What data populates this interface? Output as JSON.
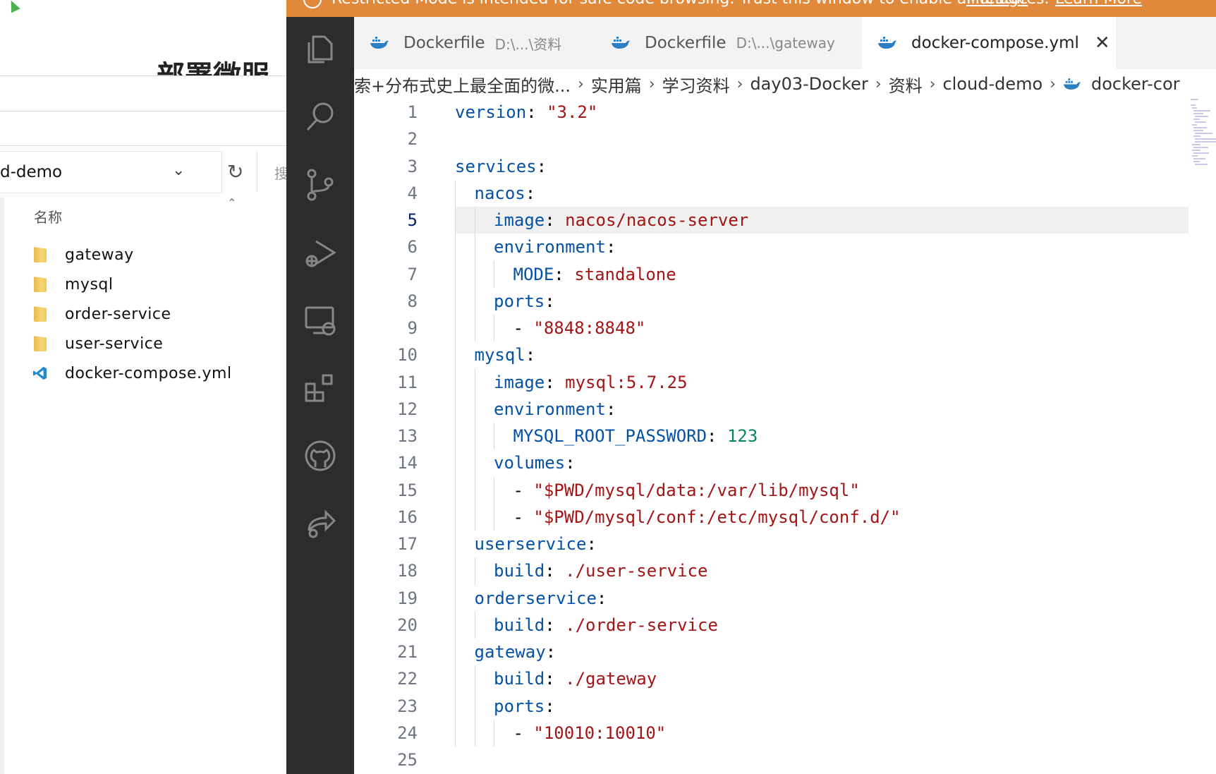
{
  "explorer": {
    "title": "部署微服",
    "path": "d-demo",
    "search_hint": "搜",
    "column_header": "名称",
    "files": [
      {
        "name": "gateway",
        "type": "folder"
      },
      {
        "name": "mysql",
        "type": "folder"
      },
      {
        "name": "order-service",
        "type": "folder"
      },
      {
        "name": "user-service",
        "type": "folder"
      },
      {
        "name": "docker-compose.yml",
        "type": "vscode-file"
      }
    ]
  },
  "vscode": {
    "banner": {
      "text": "Restricted Mode is intended for safe code browsing. Trust this window to enable all features.",
      "manage": "Manage",
      "learn_more": "Learn More"
    },
    "activity_icons": [
      "files-icon",
      "search-icon",
      "source-control-icon",
      "run-debug-icon",
      "remote-explorer-icon",
      "extensions-icon",
      "github-icon",
      "live-share-icon"
    ],
    "tabs": [
      {
        "label": "Dockerfile",
        "path": "D:\\...\\资料",
        "active": false
      },
      {
        "label": "Dockerfile",
        "path": "D:\\...\\gateway",
        "active": false
      },
      {
        "label": "docker-compose.yml",
        "path": "",
        "active": true
      }
    ],
    "breadcrumb": [
      "索+分布式史上最全面的微...",
      "实用篇",
      "学习资料",
      "day03-Docker",
      "资料",
      "cloud-demo",
      "docker-cor"
    ],
    "current_line": 5,
    "code_lines": [
      {
        "n": "1",
        "indent": 0,
        "parts": [
          [
            "k",
            "version"
          ],
          [
            "p",
            ": "
          ],
          [
            "s",
            "\"3.2\""
          ]
        ]
      },
      {
        "n": "2",
        "indent": 0,
        "parts": []
      },
      {
        "n": "3",
        "indent": 0,
        "parts": [
          [
            "k",
            "services"
          ],
          [
            "p",
            ":"
          ]
        ]
      },
      {
        "n": "4",
        "indent": 1,
        "parts": [
          [
            "k",
            "nacos"
          ],
          [
            "p",
            ":"
          ]
        ]
      },
      {
        "n": "5",
        "indent": 2,
        "parts": [
          [
            "k",
            "image"
          ],
          [
            "p",
            ": "
          ],
          [
            "v",
            "nacos/nacos-server"
          ]
        ]
      },
      {
        "n": "6",
        "indent": 2,
        "parts": [
          [
            "k",
            "environment"
          ],
          [
            "p",
            ":"
          ]
        ]
      },
      {
        "n": "7",
        "indent": 3,
        "parts": [
          [
            "k",
            "MODE"
          ],
          [
            "p",
            ": "
          ],
          [
            "v",
            "standalone"
          ]
        ]
      },
      {
        "n": "8",
        "indent": 2,
        "parts": [
          [
            "k",
            "ports"
          ],
          [
            "p",
            ":"
          ]
        ]
      },
      {
        "n": "9",
        "indent": 3,
        "parts": [
          [
            "p",
            "- "
          ],
          [
            "s",
            "\"8848:8848\""
          ]
        ]
      },
      {
        "n": "10",
        "indent": 1,
        "parts": [
          [
            "k",
            "mysql"
          ],
          [
            "p",
            ":"
          ]
        ]
      },
      {
        "n": "11",
        "indent": 2,
        "parts": [
          [
            "k",
            "image"
          ],
          [
            "p",
            ": "
          ],
          [
            "v",
            "mysql:5.7.25"
          ]
        ]
      },
      {
        "n": "12",
        "indent": 2,
        "parts": [
          [
            "k",
            "environment"
          ],
          [
            "p",
            ":"
          ]
        ]
      },
      {
        "n": "13",
        "indent": 3,
        "parts": [
          [
            "k",
            "MYSQL_ROOT_PASSWORD"
          ],
          [
            "p",
            ": "
          ],
          [
            "n",
            "123"
          ]
        ]
      },
      {
        "n": "14",
        "indent": 2,
        "parts": [
          [
            "k",
            "volumes"
          ],
          [
            "p",
            ":"
          ]
        ]
      },
      {
        "n": "15",
        "indent": 3,
        "parts": [
          [
            "p",
            "- "
          ],
          [
            "s",
            "\"$PWD/mysql/data:/var/lib/mysql\""
          ]
        ]
      },
      {
        "n": "16",
        "indent": 3,
        "parts": [
          [
            "p",
            "- "
          ],
          [
            "s",
            "\"$PWD/mysql/conf:/etc/mysql/conf.d/\""
          ]
        ]
      },
      {
        "n": "17",
        "indent": 1,
        "parts": [
          [
            "k",
            "userservice"
          ],
          [
            "p",
            ":"
          ]
        ]
      },
      {
        "n": "18",
        "indent": 2,
        "parts": [
          [
            "k",
            "build"
          ],
          [
            "p",
            ": "
          ],
          [
            "v",
            "./user-service"
          ]
        ]
      },
      {
        "n": "19",
        "indent": 1,
        "parts": [
          [
            "k",
            "orderservice"
          ],
          [
            "p",
            ":"
          ]
        ]
      },
      {
        "n": "20",
        "indent": 2,
        "parts": [
          [
            "k",
            "build"
          ],
          [
            "p",
            ": "
          ],
          [
            "v",
            "./order-service"
          ]
        ]
      },
      {
        "n": "21",
        "indent": 1,
        "parts": [
          [
            "k",
            "gateway"
          ],
          [
            "p",
            ":"
          ]
        ]
      },
      {
        "n": "22",
        "indent": 2,
        "parts": [
          [
            "k",
            "build"
          ],
          [
            "p",
            ": "
          ],
          [
            "v",
            "./gateway"
          ]
        ]
      },
      {
        "n": "23",
        "indent": 2,
        "parts": [
          [
            "k",
            "ports"
          ],
          [
            "p",
            ":"
          ]
        ]
      },
      {
        "n": "24",
        "indent": 3,
        "parts": [
          [
            "p",
            "- "
          ],
          [
            "s",
            "\"10010:10010\""
          ]
        ]
      },
      {
        "n": "25",
        "indent": 0,
        "parts": []
      }
    ],
    "colors": {
      "banner": "#e0893a",
      "activity_bar": "#2c2c2c",
      "key": "#0451a5",
      "value": "#a31515",
      "number": "#098658"
    }
  }
}
